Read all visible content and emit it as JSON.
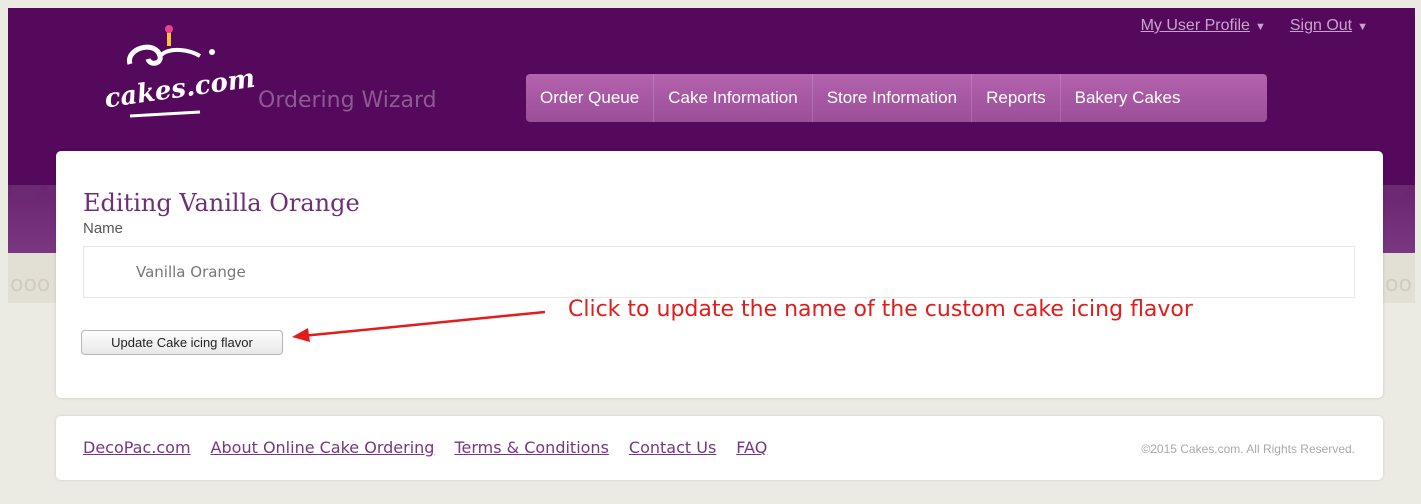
{
  "header": {
    "logo_text": "cakes.com",
    "app_title": "Ordering Wizard",
    "user_links": [
      {
        "label": "My User Profile"
      },
      {
        "label": "Sign Out"
      }
    ],
    "nav": [
      {
        "label": "Order Queue"
      },
      {
        "label": "Cake Information"
      },
      {
        "label": "Store Information"
      },
      {
        "label": "Reports"
      },
      {
        "label": "Bakery Cakes"
      }
    ]
  },
  "form": {
    "title": "Editing Vanilla Orange",
    "name_label": "Name",
    "name_value": "Vanilla Orange",
    "submit_label": "Update Cake icing flavor"
  },
  "annotation": {
    "text": "Click to update the name of the custom cake icing flavor",
    "color": "#e21b1b"
  },
  "footer": {
    "links": [
      {
        "label": "DecoPac.com"
      },
      {
        "label": "About Online Cake Ordering"
      },
      {
        "label": "Terms & Conditions"
      },
      {
        "label": "Contact Us"
      },
      {
        "label": "FAQ"
      }
    ],
    "copyright": "©2015 Cakes.com. All Rights Reserved."
  },
  "colors": {
    "brand_purple": "#54095c",
    "nav_pink": "#b463ad"
  }
}
